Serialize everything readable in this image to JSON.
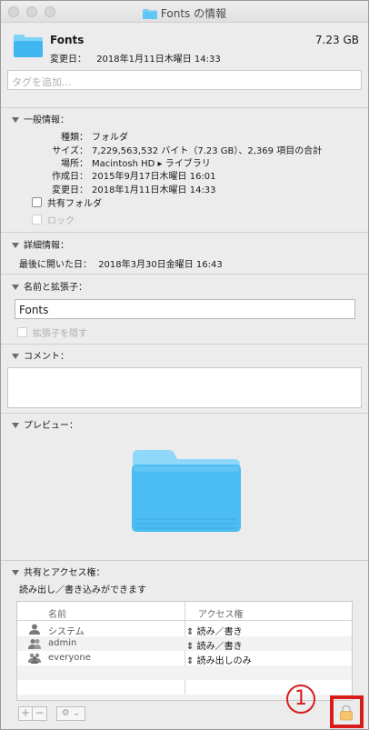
{
  "window": {
    "title": "Fonts の情報"
  },
  "header": {
    "name": "Fonts",
    "size": "7.23 GB",
    "modified_label": "変更日：",
    "modified_value": "2018年1月11日木曜日 14:33"
  },
  "tags": {
    "placeholder": "タグを追加..."
  },
  "general": {
    "title": "一般情報：",
    "rows": [
      {
        "key": "種類：",
        "value": "フォルダ"
      },
      {
        "key": "サイズ：",
        "value": "7,229,563,532 バイト（7.23 GB）、2,369 項目の合計"
      },
      {
        "key": "場所：",
        "value": "Macintosh HD ▸ ライブラリ"
      },
      {
        "key": "作成日：",
        "value": "2015年9月17日木曜日 16:01"
      },
      {
        "key": "変更日：",
        "value": "2018年1月11日木曜日 14:33"
      }
    ],
    "shared_folder": "共有フォルダ",
    "locked": "ロック"
  },
  "more_info": {
    "title": "詳細情報：",
    "last_opened_label": "最後に開いた日：",
    "last_opened_value": "2018年3月30日金曜日 16:43"
  },
  "name_ext": {
    "title": "名前と拡張子：",
    "value": "Fonts",
    "hide_ext": "拡張子を隠す"
  },
  "comments": {
    "title": "コメント："
  },
  "preview": {
    "title": "プレビュー："
  },
  "sharing": {
    "title": "共有とアクセス権：",
    "status": "読み出し／書き込みができます",
    "col_name": "名前",
    "col_access": "アクセス権",
    "rows": [
      {
        "name": "システム",
        "access": "読み／書き",
        "icon": "user-icon"
      },
      {
        "name": "admin",
        "access": "読み／書き",
        "icon": "group-icon"
      },
      {
        "name": "everyone",
        "access": "読み出しのみ",
        "icon": "everyone-icon"
      }
    ],
    "add_label": "+",
    "remove_label": "−",
    "gear_label": "⚙ ⌄"
  },
  "annotation": {
    "callout_number": "1"
  },
  "colors": {
    "folder": "#5ec6f5",
    "highlight": "#d81c1c",
    "lock": "#f5c46c"
  }
}
